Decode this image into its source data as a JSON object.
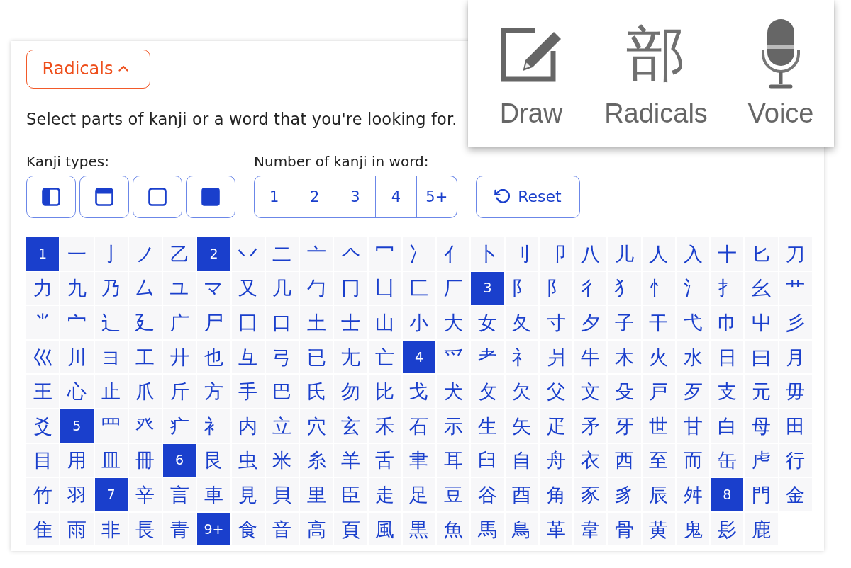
{
  "input_modes": [
    {
      "kind": "draw",
      "label": "Draw"
    },
    {
      "kind": "radicals",
      "glyph": "部",
      "label": "Radicals"
    },
    {
      "kind": "voice",
      "label": "Voice"
    }
  ],
  "radicals_toggle": {
    "label": "Radicals",
    "expanded": true
  },
  "instructions": "Select parts of kanji or a word that you're looking for.",
  "kanji_types": {
    "label": "Kanji types:",
    "options": [
      {
        "kind": "left-half"
      },
      {
        "kind": "top-band"
      },
      {
        "kind": "outline"
      },
      {
        "kind": "filled"
      }
    ]
  },
  "kanji_count": {
    "label": "Number of kanji in word:",
    "options": [
      "1",
      "2",
      "3",
      "4",
      "5+"
    ]
  },
  "reset_button": {
    "label": "Reset"
  },
  "radical_groups": [
    {
      "stroke_count": "1",
      "radicals": [
        "一",
        "亅",
        "ノ",
        "乙"
      ]
    },
    {
      "stroke_count": "2",
      "radicals": [
        "丷",
        "二",
        "亠",
        "𠆢",
        "冖",
        "冫",
        "亻",
        "卜",
        "刂",
        "卩",
        "八",
        "儿",
        "人",
        "入",
        "十",
        "匕",
        "刀",
        "力",
        "九",
        "乃",
        "厶",
        "ユ",
        "マ",
        "又",
        "几",
        "勹",
        "冂",
        "凵",
        "匚",
        "厂"
      ]
    },
    {
      "stroke_count": "3",
      "radicals": [
        "阝",
        "阝",
        "彳",
        "犭",
        "忄",
        "氵",
        "扌",
        "幺",
        "艹",
        "⺌",
        "宀",
        "辶",
        "廴",
        "广",
        "尸",
        "囗",
        "口",
        "土",
        "士",
        "山",
        "小",
        "大",
        "女",
        "夂",
        "寸",
        "夕",
        "子",
        "干",
        "弋",
        "巾",
        "屮",
        "彡",
        "巛",
        "川",
        "ヨ",
        "工",
        "廾",
        "也",
        "彑",
        "弓",
        "已",
        "尢",
        "亡"
      ]
    },
    {
      "stroke_count": "4",
      "radicals": [
        "⺤",
        "耂",
        "礻",
        "爿",
        "牛",
        "木",
        "火",
        "水",
        "日",
        "曰",
        "月",
        "王",
        "心",
        "止",
        "爪",
        "斤",
        "方",
        "手",
        "巴",
        "氏",
        "勿",
        "比",
        "戈",
        "犬",
        "攵",
        "欠",
        "父",
        "文",
        "殳",
        "戸",
        "歹",
        "支",
        "元",
        "毋",
        "爻"
      ]
    },
    {
      "stroke_count": "5",
      "radicals": [
        "罒",
        "癶",
        "疒",
        "衤",
        "内",
        "立",
        "穴",
        "玄",
        "禾",
        "石",
        "示",
        "生",
        "矢",
        "疋",
        "矛",
        "牙",
        "世",
        "甘",
        "白",
        "母",
        "田",
        "目",
        "用",
        "皿",
        "冊"
      ]
    },
    {
      "stroke_count": "6",
      "radicals": [
        "艮",
        "虫",
        "米",
        "糸",
        "羊",
        "舌",
        "聿",
        "耳",
        "臼",
        "自",
        "舟",
        "衣",
        "西",
        "至",
        "而",
        "缶",
        "虍",
        "行",
        "竹",
        "羽"
      ]
    },
    {
      "stroke_count": "7",
      "radicals": [
        "辛",
        "言",
        "車",
        "見",
        "貝",
        "里",
        "臣",
        "走",
        "足",
        "豆",
        "谷",
        "酉",
        "角",
        "豕",
        "豸",
        "辰",
        "舛"
      ]
    },
    {
      "stroke_count": "8",
      "radicals": [
        "門",
        "金",
        "隹",
        "雨",
        "非",
        "長",
        "青"
      ]
    },
    {
      "stroke_count": "9+",
      "radicals": [
        "食",
        "音",
        "高",
        "頁",
        "風",
        "黒",
        "魚",
        "馬",
        "鳥",
        "革",
        "韋",
        "骨",
        "黄",
        "鬼",
        "髟",
        "鹿"
      ]
    }
  ]
}
